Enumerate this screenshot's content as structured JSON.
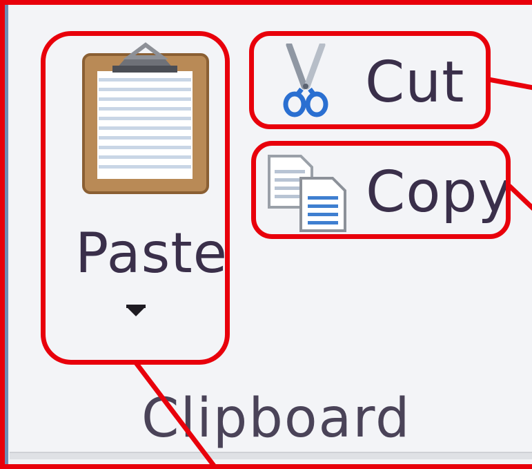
{
  "ribbon_group": {
    "name": "Clipboard",
    "paste": {
      "label": "Paste",
      "icon": "clipboard-icon",
      "dropdown_icon": "chevron-down-icon"
    },
    "cut": {
      "label": "Cut",
      "icon": "scissors-icon"
    },
    "copy": {
      "label": "Copy",
      "icon": "copy-icon"
    }
  },
  "colors": {
    "highlight": "#e8000b",
    "background": "#f3f4f7",
    "label_text": "#3a2f4a"
  }
}
